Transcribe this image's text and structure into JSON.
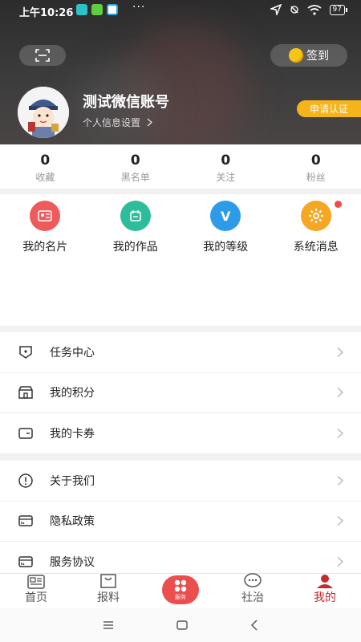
{
  "statusbar": {
    "time": "上午10:26",
    "dots": "···",
    "battery": "97"
  },
  "header": {
    "checkin_label": "签到",
    "username": "测试微信账号",
    "profile_settings": "个人信息设置",
    "apply_cert": "申请认证"
  },
  "stats": [
    {
      "value": "0",
      "label": "收藏"
    },
    {
      "value": "0",
      "label": "黑名单"
    },
    {
      "value": "0",
      "label": "关注"
    },
    {
      "value": "0",
      "label": "粉丝"
    }
  ],
  "quick_menu": [
    {
      "label": "我的名片",
      "icon": "card-icon",
      "color": "#ef5b5b"
    },
    {
      "label": "我的作品",
      "icon": "works-icon",
      "color": "#2ebd9b"
    },
    {
      "label": "我的等级",
      "icon": "v-icon",
      "glyph": "V",
      "color": "#2e9be8"
    },
    {
      "label": "系统消息",
      "icon": "gear-icon",
      "color": "#f5a623"
    }
  ],
  "list_group1": [
    {
      "label": "任务中心",
      "icon": "task-icon"
    },
    {
      "label": "我的积分",
      "icon": "points-icon"
    },
    {
      "label": "我的卡券",
      "icon": "coupon-icon"
    }
  ],
  "list_group2": [
    {
      "label": "关于我们",
      "icon": "info-icon"
    },
    {
      "label": "隐私政策",
      "icon": "privacy-icon"
    },
    {
      "label": "服务协议",
      "icon": "agreement-icon"
    }
  ],
  "tabbar": {
    "tabs": [
      {
        "label": "首页",
        "icon": "home-icon"
      },
      {
        "label": "报料",
        "icon": "report-icon"
      },
      {
        "label": "服务",
        "icon": "service-icon"
      },
      {
        "label": "社治",
        "icon": "chat-icon"
      },
      {
        "label": "我的",
        "icon": "user-icon"
      }
    ],
    "active_color": "#c9282d"
  }
}
